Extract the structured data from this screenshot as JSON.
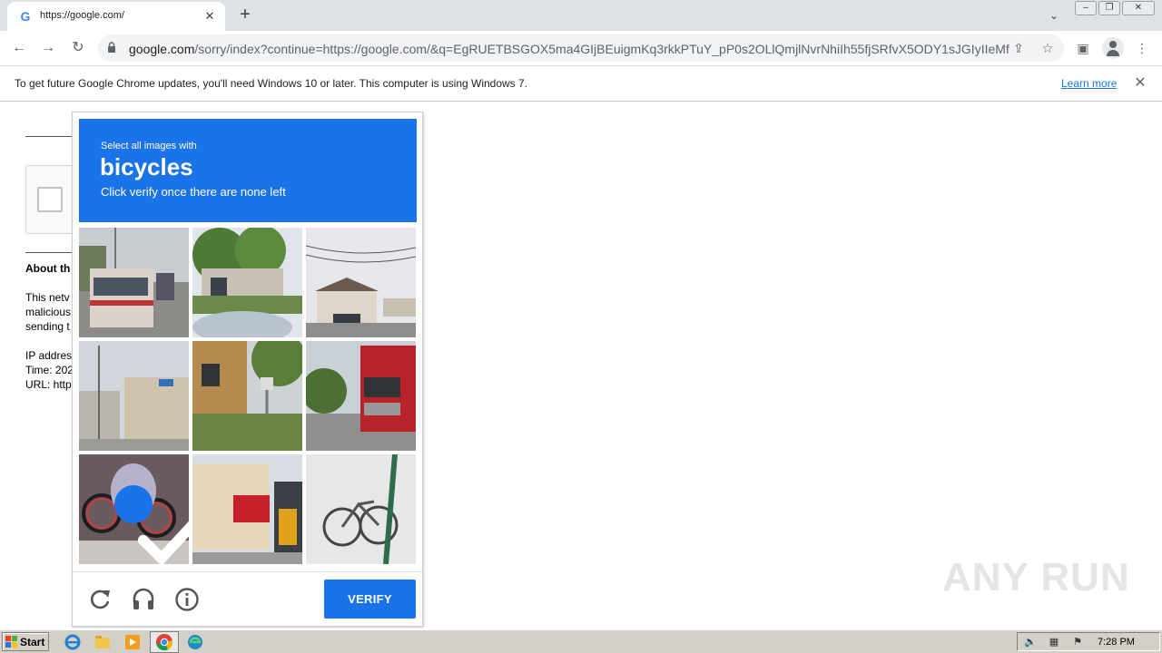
{
  "browser": {
    "tab": {
      "title": "https://google.com/",
      "favicon_letter": "G"
    },
    "new_tab_label": "+",
    "window_controls": {
      "minimize": "‒",
      "restore": "❐",
      "close": "✕"
    },
    "url_host": "google.com",
    "url_rest": "/sorry/index?continue=https://google.com/&q=EgRUETBSGOX5ma4GIjBEuigmKq3rkkPTuY_pP0s2OLlQmjlNvrNhiIh55fjSRfvX5ODY1sJGIyIIeMf...",
    "infobar": {
      "message": "To get future Google Chrome updates, you'll need Windows 10 or later. This computer is using Windows 7.",
      "link": "Learn more"
    }
  },
  "page": {
    "about_title": "About th",
    "about_lines": [
      "This netv",
      "malicious",
      "sending t",
      "IP addres",
      "Time: 202",
      "URL: http"
    ]
  },
  "challenge": {
    "instruction": "Select all images with",
    "target": "bicycles",
    "subtext": "Click verify once there are none left",
    "tiles": [
      {
        "subject": "street with bus",
        "selected": false
      },
      {
        "subject": "house with trees",
        "selected": false
      },
      {
        "subject": "house with power lines",
        "selected": false
      },
      {
        "subject": "narrow street with sign",
        "selected": false
      },
      {
        "subject": "garden with mailbox",
        "selected": false
      },
      {
        "subject": "red truck",
        "selected": false
      },
      {
        "subject": "bicycles",
        "selected": true
      },
      {
        "subject": "storefront",
        "selected": false
      },
      {
        "subject": "bicycle",
        "selected": false
      }
    ],
    "verify_label": "VERIFY"
  },
  "watermark": "ANY RUN",
  "taskbar": {
    "start_label": "Start",
    "clock": "7:28 PM"
  },
  "colors": {
    "accent": "#1a73e8",
    "tabstrip": "#dee1e6",
    "taskbar": "#d4d0c8"
  }
}
